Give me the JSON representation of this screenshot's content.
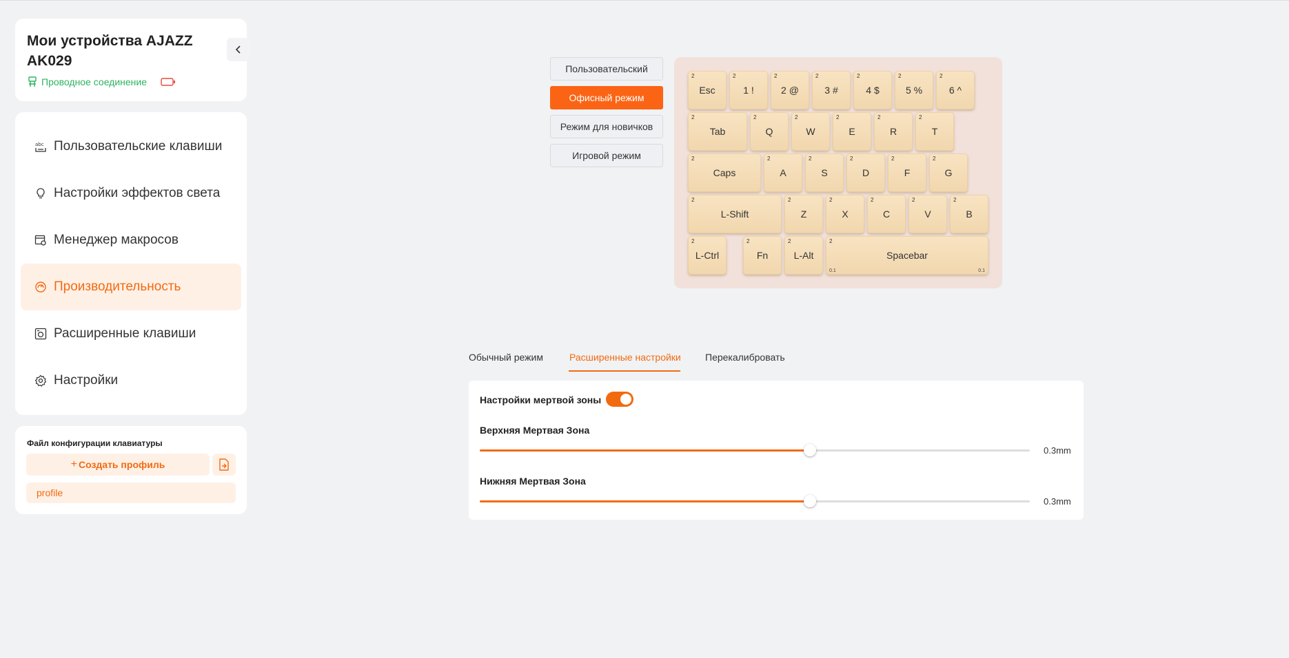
{
  "device": {
    "title": "Мои устройства AJAZZ AK029",
    "connection": "Проводное соединение",
    "colors": {
      "connected": "#2eb360",
      "battery": "#e8483c"
    }
  },
  "nav": {
    "items": [
      {
        "label": "Пользовательские клавиши",
        "icon": "abc-icon"
      },
      {
        "label": "Настройки эффектов света",
        "icon": "lightbulb-icon"
      },
      {
        "label": "Менеджер макросов",
        "icon": "macro-icon"
      },
      {
        "label": "Производительность",
        "icon": "gauge-icon",
        "active": true
      },
      {
        "label": "Расширенные клавиши",
        "icon": "advanced-key-icon"
      },
      {
        "label": "Настройки",
        "icon": "gear-icon"
      }
    ]
  },
  "profiles": {
    "heading": "Файл конфигурации клавиатуры",
    "create_label": "Создать профиль",
    "create_prefix": "+",
    "items": [
      "profile"
    ]
  },
  "modes": [
    {
      "label": "Пользовательский"
    },
    {
      "label": "Офисный режим",
      "active": true
    },
    {
      "label": "Режим для новичков"
    },
    {
      "label": "Игровой режим"
    }
  ],
  "keyboard": {
    "rows": [
      [
        {
          "label": "Esc",
          "sup": "2"
        },
        {
          "label": "1 !",
          "sup": "2"
        },
        {
          "label": "2 @",
          "sup": "2"
        },
        {
          "label": "3 #",
          "sup": "2"
        },
        {
          "label": "4 $",
          "sup": "2"
        },
        {
          "label": "5 %",
          "sup": "2"
        },
        {
          "label": "6 ^",
          "sup": "2"
        }
      ],
      [
        {
          "label": "Tab",
          "sup": "2"
        },
        {
          "label": "Q",
          "sup": "2"
        },
        {
          "label": "W",
          "sup": "2"
        },
        {
          "label": "E",
          "sup": "2"
        },
        {
          "label": "R",
          "sup": "2"
        },
        {
          "label": "T",
          "sup": "2"
        }
      ],
      [
        {
          "label": "Caps",
          "sup": "2"
        },
        {
          "label": "A",
          "sup": "2"
        },
        {
          "label": "S",
          "sup": "2"
        },
        {
          "label": "D",
          "sup": "2"
        },
        {
          "label": "F",
          "sup": "2"
        },
        {
          "label": "G",
          "sup": "2"
        }
      ],
      [
        {
          "label": "L-Shift",
          "sup": "2"
        },
        {
          "label": "Z",
          "sup": "2"
        },
        {
          "label": "X",
          "sup": "2"
        },
        {
          "label": "C",
          "sup": "2"
        },
        {
          "label": "V",
          "sup": "2"
        },
        {
          "label": "B",
          "sup": "2"
        }
      ],
      [
        {
          "label": "L-Ctrl",
          "sup": "2"
        },
        {
          "label": "Fn",
          "sup": "2"
        },
        {
          "label": "L-Alt",
          "sup": "2"
        },
        {
          "label": "Spacebar",
          "sup": "2",
          "sub_left": "0.1",
          "sub_right": "0.1"
        }
      ]
    ]
  },
  "tabs": [
    {
      "label": "Обычный режим"
    },
    {
      "label": "Расширенные настройки",
      "active": true
    },
    {
      "label": "Перекалибровать"
    }
  ],
  "deadzone": {
    "label": "Настройки мертвой зоны",
    "enabled": true,
    "upper": {
      "label": "Верхняя Мертвая Зона",
      "value_text": "0.3mm",
      "fraction": 0.6
    },
    "lower": {
      "label": "Нижняя Мертвая Зона",
      "value_text": "0.3mm",
      "fraction": 0.6
    }
  },
  "colors": {
    "accent": "#f26a10",
    "accent_light": "#fff0e6",
    "keycap": "#f4dcb5",
    "keyboard_bg": "#f1e1da"
  }
}
